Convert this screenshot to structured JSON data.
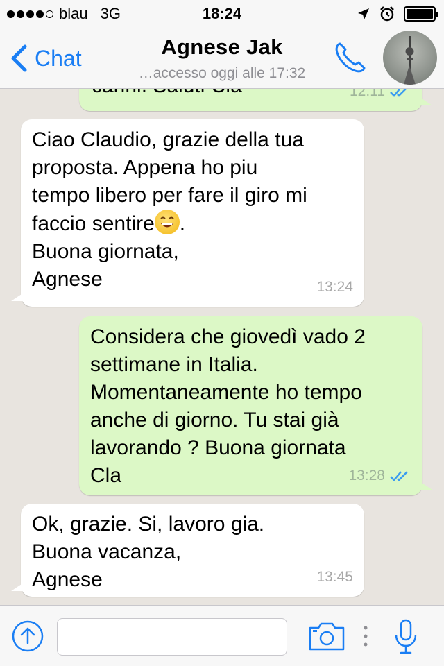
{
  "status_bar": {
    "carrier": "blau",
    "network": "3G",
    "time": "18:24"
  },
  "header": {
    "back_label": "Chat",
    "contact_name": "Agnese Jak",
    "last_seen": "…accesso oggi alle 17:32",
    "accent_color": "#1a7ef4"
  },
  "messages": [
    {
      "direction": "out",
      "text": "carini. Saluti Cla",
      "time": "12:11",
      "read": true
    },
    {
      "direction": "in",
      "text_before_emoji": "Ciao Claudio, grazie della tua\nproposta. Appena ho piu\ntempo libero per fare il giro mi\nfaccio sentire",
      "emoji": "smile-emoji",
      "text_after_emoji": ".\nBuona giornata,\nAgnese",
      "time": "13:24"
    },
    {
      "direction": "out",
      "text": "Considera che giovedì vado 2\nsettimane in Italia.\nMomentaneamente ho tempo\nanche di giorno. Tu stai già\nlavorando ? Buona giornata\nCla",
      "time": "13:28",
      "read": true
    },
    {
      "direction": "in",
      "text": "Ok, grazie. Si, lavoro gia.\nBuona vacanza,\nAgnese",
      "time": "13:45"
    }
  ],
  "input_bar": {
    "placeholder": "",
    "value": ""
  },
  "colors": {
    "outgoing_bubble": "#dcf8c6",
    "incoming_bubble": "#ffffff",
    "background": "#e8e4df",
    "read_ticks": "#3b9cf0"
  }
}
